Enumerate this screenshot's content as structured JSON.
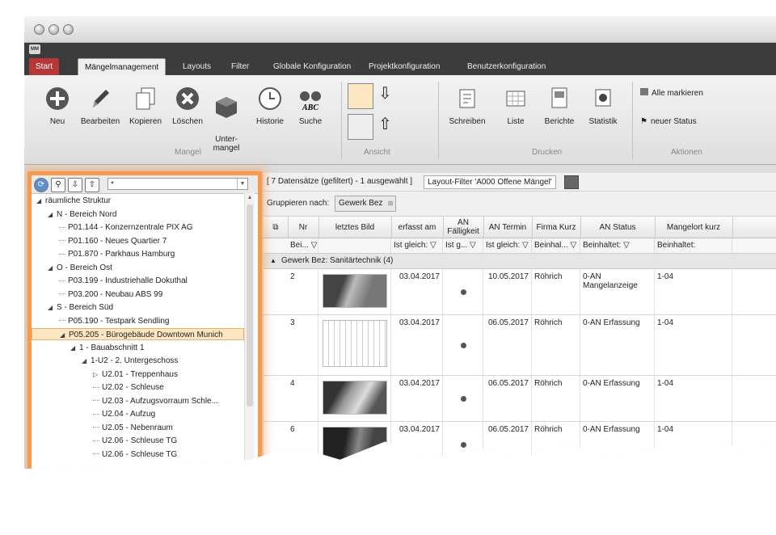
{
  "titlebar": {
    "app_icon": "MM"
  },
  "tabs": [
    "Start",
    "Mängelmanagement",
    "Layouts",
    "Filter",
    "Globale Konfiguration",
    "Projektkonfiguration",
    "Benutzerkonfiguration"
  ],
  "ribbon": {
    "buttons": [
      {
        "label": "Neu",
        "icon": "plus-icon"
      },
      {
        "label": "Bearbeiten",
        "icon": "pencil-icon"
      },
      {
        "label": "Kopieren",
        "icon": "copy-icon"
      },
      {
        "label": "Löschen",
        "icon": "delete-icon"
      },
      {
        "label": "Unter-\nmangel",
        "icon": "cube-icon"
      },
      {
        "label": "Historie",
        "icon": "clock-icon"
      },
      {
        "label": "Suche",
        "icon": "binoculars-icon"
      }
    ],
    "group_mangel": "Mangel",
    "group_ansicht": "Ansicht",
    "print_buttons": [
      {
        "label": "Schreiben"
      },
      {
        "label": "Liste"
      },
      {
        "label": "Berichte"
      },
      {
        "label": "Statistik"
      }
    ],
    "group_drucken": "Drucken",
    "actions": [
      "Alle markieren",
      "neuer Status"
    ],
    "group_aktionen": "Aktionen"
  },
  "tree": {
    "filter_value": "*",
    "nodes": [
      {
        "label": "räumliche Struktur",
        "level": 0,
        "exp": "◢"
      },
      {
        "label": "N - Bereich Nord",
        "level": 1,
        "exp": "◢"
      },
      {
        "label": "P01.144 - Konzernzentrale PIX AG",
        "level": 2,
        "exp": ""
      },
      {
        "label": "P01.160 - Neues Quartier 7",
        "level": 2,
        "exp": ""
      },
      {
        "label": "P01.870  - Parkhaus Hamburg",
        "level": 2,
        "exp": ""
      },
      {
        "label": "O - Bereich Ost",
        "level": 1,
        "exp": "◢"
      },
      {
        "label": "P03.199 - Industriehalle Dokuthal",
        "level": 2,
        "exp": ""
      },
      {
        "label": "P03.200 - Neubau ABS 99",
        "level": 2,
        "exp": ""
      },
      {
        "label": "S - Bereich Süd",
        "level": 1,
        "exp": "◢"
      },
      {
        "label": "P05.190 - Testpark Sendling",
        "level": 2,
        "exp": ""
      },
      {
        "label": "P05.205 - Bürogebäude Downtown Munich",
        "level": 2,
        "exp": "◢",
        "selected": true
      },
      {
        "label": "1 - Bauabschnitt 1",
        "level": 3,
        "exp": "◢"
      },
      {
        "label": "1-U2 - 2. Untergeschoss",
        "level": 4,
        "exp": "◢"
      },
      {
        "label": "U2.01 - Treppenhaus",
        "level": 5,
        "exp": "▷"
      },
      {
        "label": "U2.02 - Schleuse",
        "level": 5,
        "exp": ""
      },
      {
        "label": "U2.03 - Aufzugsvorraum Schle...",
        "level": 5,
        "exp": ""
      },
      {
        "label": "U2.04 - Aufzug",
        "level": 5,
        "exp": ""
      },
      {
        "label": "U2.05 - Nebenraum",
        "level": 5,
        "exp": ""
      },
      {
        "label": "U2.06 - Schleuse TG",
        "level": 5,
        "exp": ""
      },
      {
        "label": "U2.06 - Schleuse TG",
        "level": 5,
        "exp": ""
      }
    ]
  },
  "grid": {
    "info": "[ 7 Datensätze (gefiltert) - 1 ausgewählt ]",
    "layout_filter": "Layout-Filter 'A000 Offene Mängel'",
    "group_by_label": "Gruppieren nach:",
    "group_chip": "Gewerk Bez",
    "columns": [
      "Nr",
      "letztes Bild",
      "erfasst am",
      "AN\nFälligkeit",
      "AN Termin",
      "Firma Kurz",
      "AN Status",
      "Mangelort kurz"
    ],
    "filters": [
      "Bei... ▽",
      "",
      "Ist gleich: ▽",
      "Ist g... ▽",
      "Ist gleich: ▽",
      "Beinhal... ▽",
      "Beinhaltet:          ▽",
      "Beinhaltet:"
    ],
    "group_row": "Gewerk Bez: Sanitärtechnik (4)",
    "rows": [
      {
        "nr": "2",
        "erfasst": "03.04.2017",
        "termin": "10.05.2017",
        "firma": "Röhrich",
        "status": "0-AN\nMangelanzeige",
        "ort": "1-04"
      },
      {
        "nr": "3",
        "erfasst": "03.04.2017",
        "termin": "06.05.2017",
        "firma": "Röhrich",
        "status": "0-AN Erfassung",
        "ort": "1-04"
      },
      {
        "nr": "4",
        "erfasst": "03.04.2017",
        "termin": "06.05.2017",
        "firma": "Röhrich",
        "status": "0-AN Erfassung",
        "ort": "1-04"
      },
      {
        "nr": "6",
        "erfasst": "03.04.2017",
        "termin": "06.05.2017",
        "firma": "Röhrich",
        "status": "0-AN Erfassung",
        "ort": "1-04"
      }
    ]
  },
  "colors": {
    "highlight": "#f59a4e",
    "start_tab": "#b43838"
  }
}
